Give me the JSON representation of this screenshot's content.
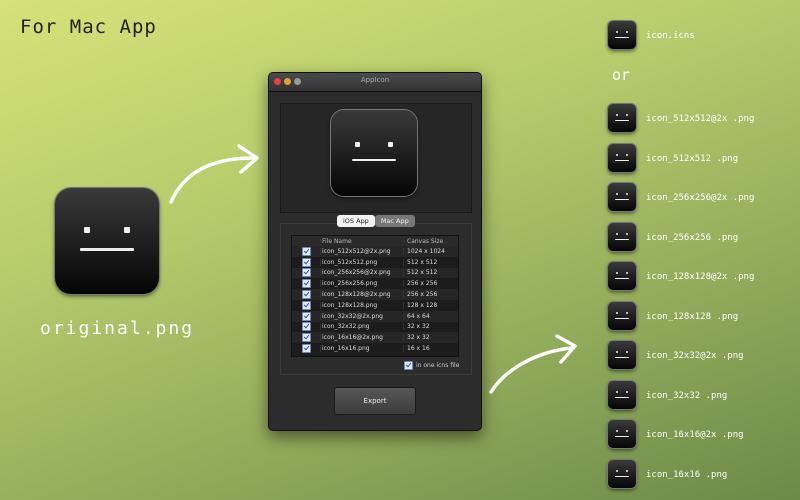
{
  "headline": "For Mac App",
  "original_caption": "original.png",
  "window": {
    "title": "AppIcon",
    "tabs": [
      "iOS App",
      "Mac App"
    ],
    "active_tab": "iOS App",
    "table": {
      "headers": [
        "",
        "File Name",
        "Canvas Size"
      ],
      "rows": [
        {
          "name": "icon_512x512@2x.png",
          "size": "1024 x 1024",
          "checked": true
        },
        {
          "name": "icon_512x512.png",
          "size": "512 x 512",
          "checked": true
        },
        {
          "name": "icon_256x256@2x.png",
          "size": "512 x 512",
          "checked": true
        },
        {
          "name": "icon_256x256.png",
          "size": "256 x 256",
          "checked": true
        },
        {
          "name": "icon_128x128@2x.png",
          "size": "256 x 256",
          "checked": true
        },
        {
          "name": "icon_128x128.png",
          "size": "128 x 128",
          "checked": true
        },
        {
          "name": "icon_32x32@2x.png",
          "size": "64 x 64",
          "checked": true
        },
        {
          "name": "icon_32x32.png",
          "size": "32 x 32",
          "checked": true
        },
        {
          "name": "icon_16x16@2x.png",
          "size": "32 x 32",
          "checked": true
        },
        {
          "name": "icon_16x16.png",
          "size": "16 x 16",
          "checked": true
        }
      ]
    },
    "one_file_label": "in one icns file",
    "one_file_checked": true,
    "export_label": "Export"
  },
  "output": {
    "top_file": "icon.icns",
    "or_label": "or",
    "files": [
      "icon_512x512@2x .png",
      "icon_512x512 .png",
      "icon_256x256@2x .png",
      "icon_256x256 .png",
      "icon_128x128@2x .png",
      "icon_128x128 .png",
      "icon_32x32@2x .png",
      "icon_32x32 .png",
      "icon_16x16@2x .png",
      "icon_16x16 .png"
    ]
  },
  "colors": {
    "background_top": "#d6e278",
    "background_bottom": "#6c8a48",
    "window": "#2c2c2c",
    "checkbox": "#2a5aa8"
  },
  "icons": [
    "blank-face-app-icon",
    "curved-arrow-icon",
    "checkbox-icon"
  ]
}
